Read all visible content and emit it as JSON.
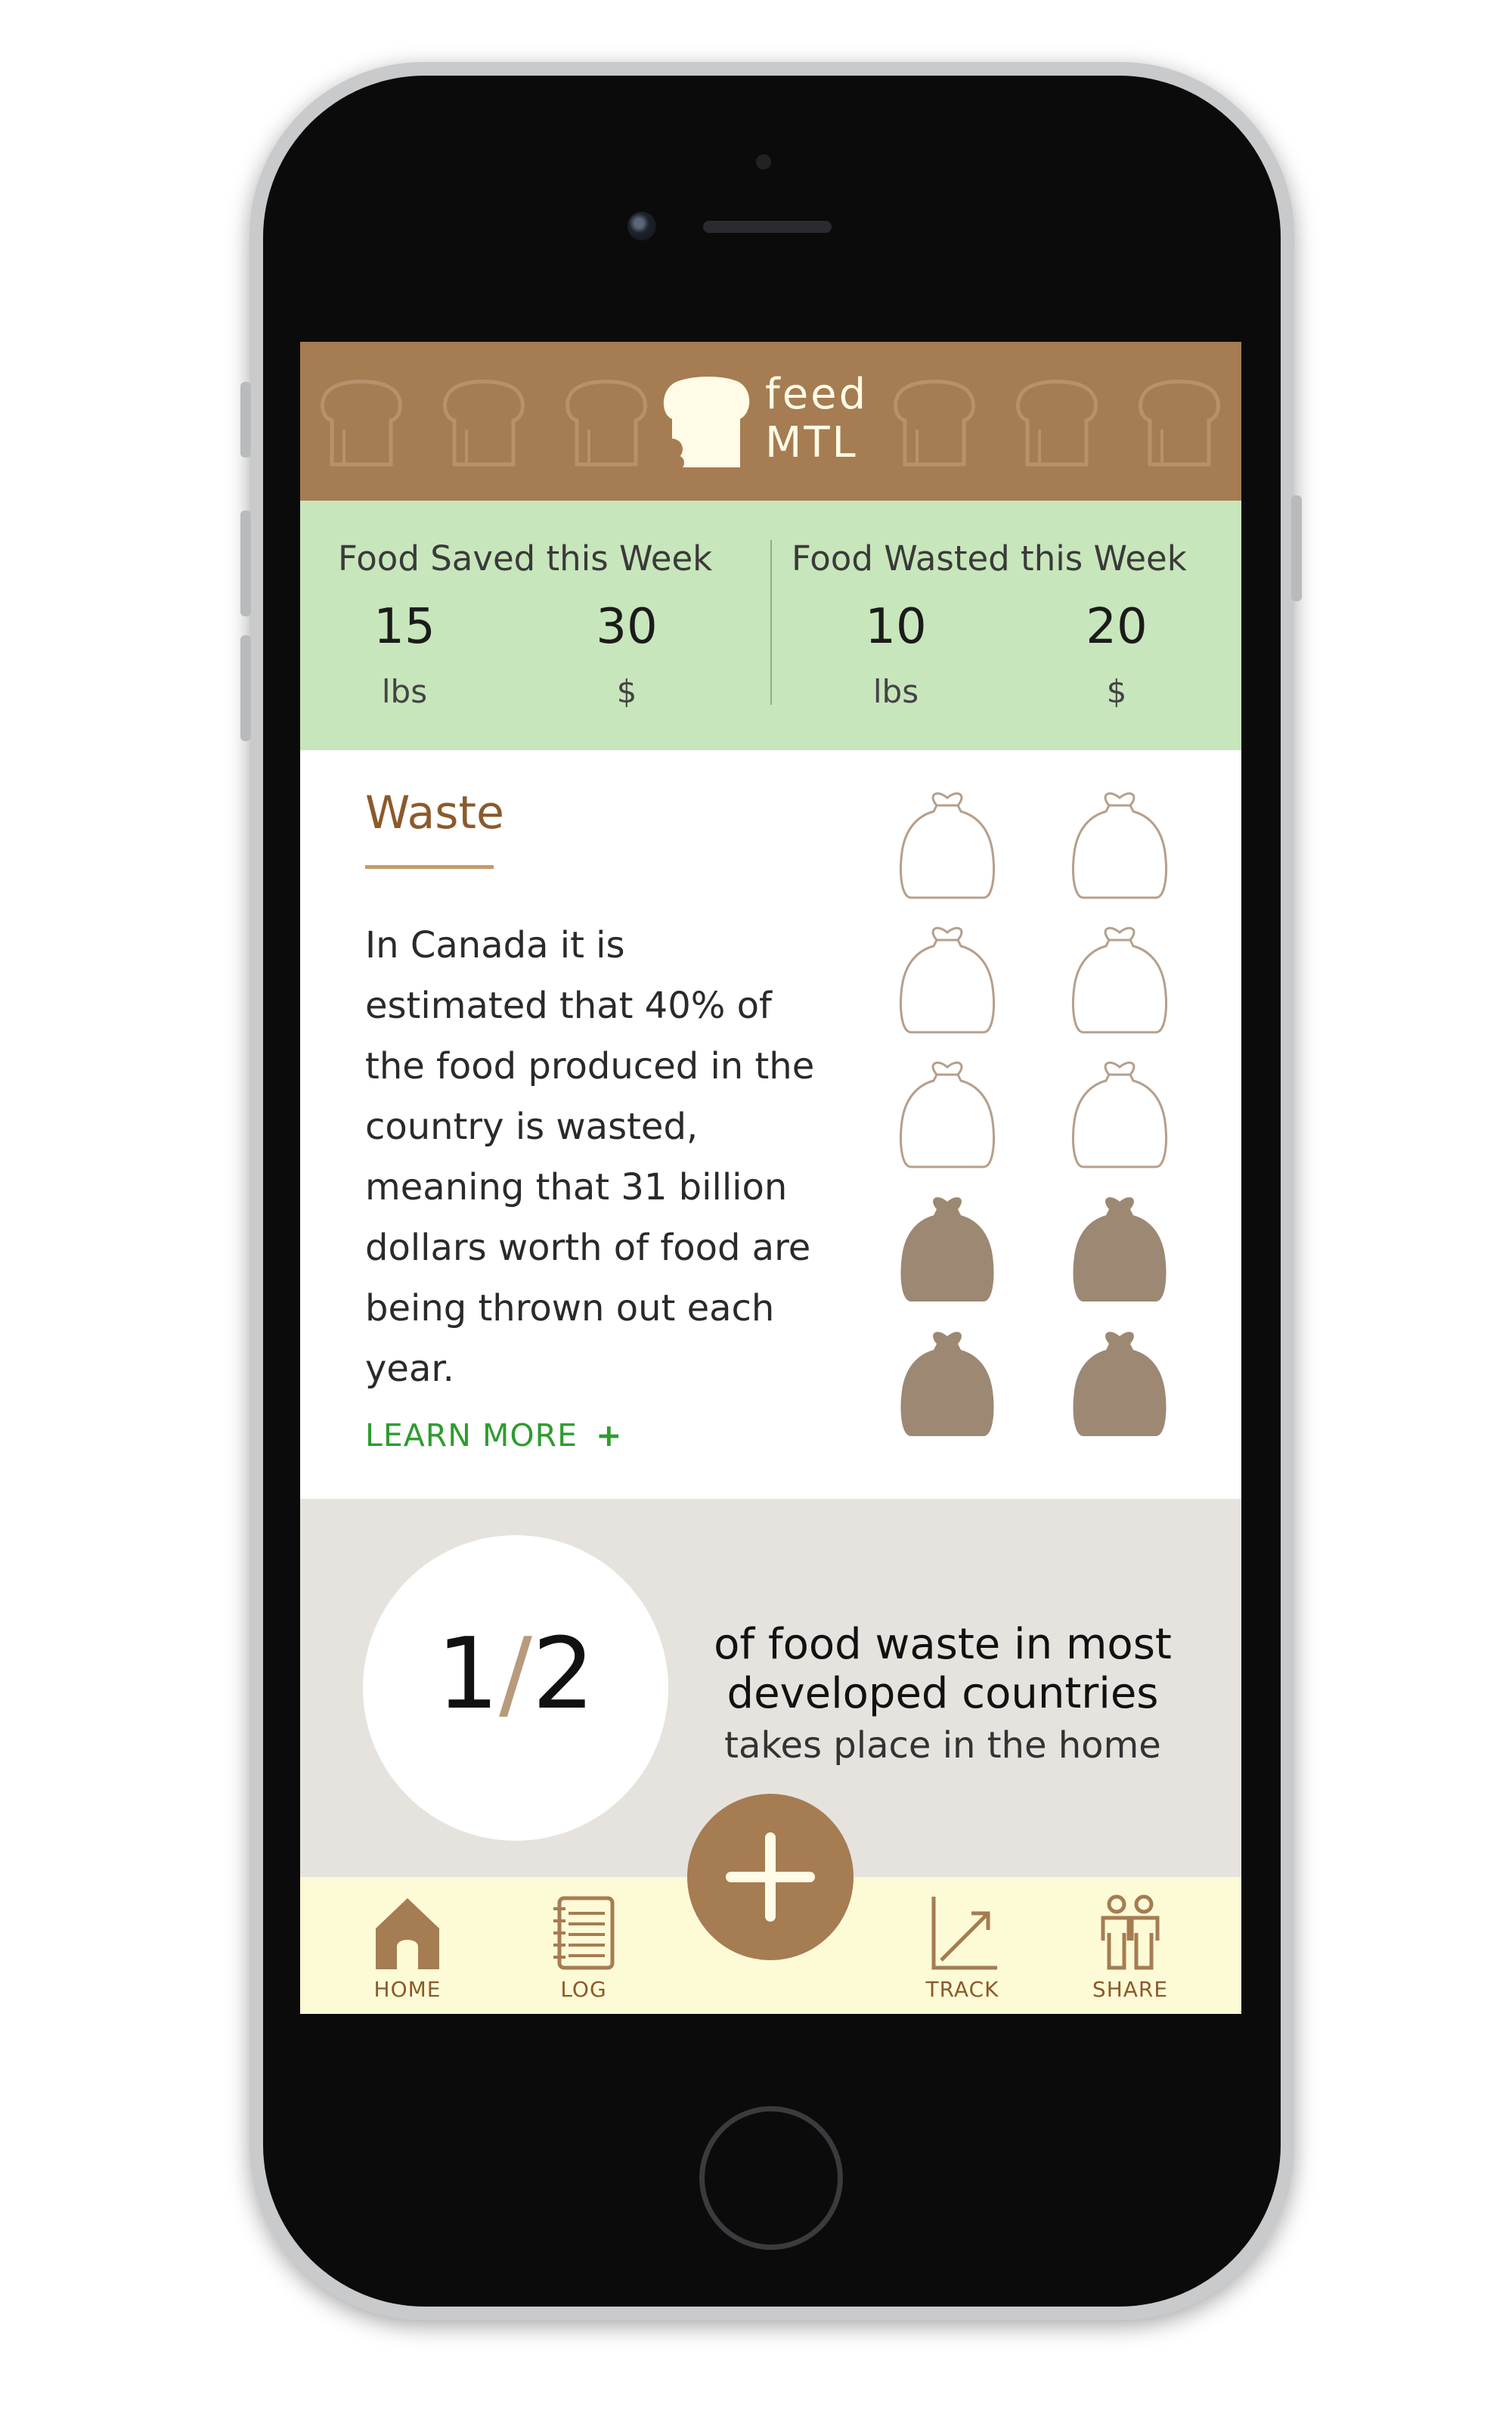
{
  "app": {
    "brand_line1": "feed",
    "brand_line2": "MTL"
  },
  "colors": {
    "header": "#a67c52",
    "stats_bg": "#c8e6bb",
    "accent_green": "#2e9c2e",
    "bag_filled": "#9c8873",
    "nav_bg": "#fdfbd6"
  },
  "stats": {
    "saved": {
      "title": "Food Saved this Week",
      "weight": "15",
      "weight_unit": "lbs",
      "money": "30",
      "money_unit": "$"
    },
    "wasted": {
      "title": "Food Wasted this Week",
      "weight": "10",
      "weight_unit": "lbs",
      "money": "20",
      "money_unit": "$"
    }
  },
  "waste": {
    "title": "Waste",
    "body": "In Canada it is estimated that 40% of the food produced in the country is wasted, meaning that 31 billion dollars worth of food are being thrown out each year.",
    "learn_more": "LEARN MORE",
    "learn_more_icon": "plus-icon",
    "bags_total": 10,
    "bags_filled": 4
  },
  "fact": {
    "num": "1",
    "slash": "/",
    "den": "2",
    "line1": "of food waste in most",
    "line2": "developed countries",
    "line3": "takes place in the home"
  },
  "nav": {
    "home": "HOME",
    "log": "LOG",
    "track": "TRACK",
    "share": "SHARE",
    "add_icon": "plus-icon"
  }
}
